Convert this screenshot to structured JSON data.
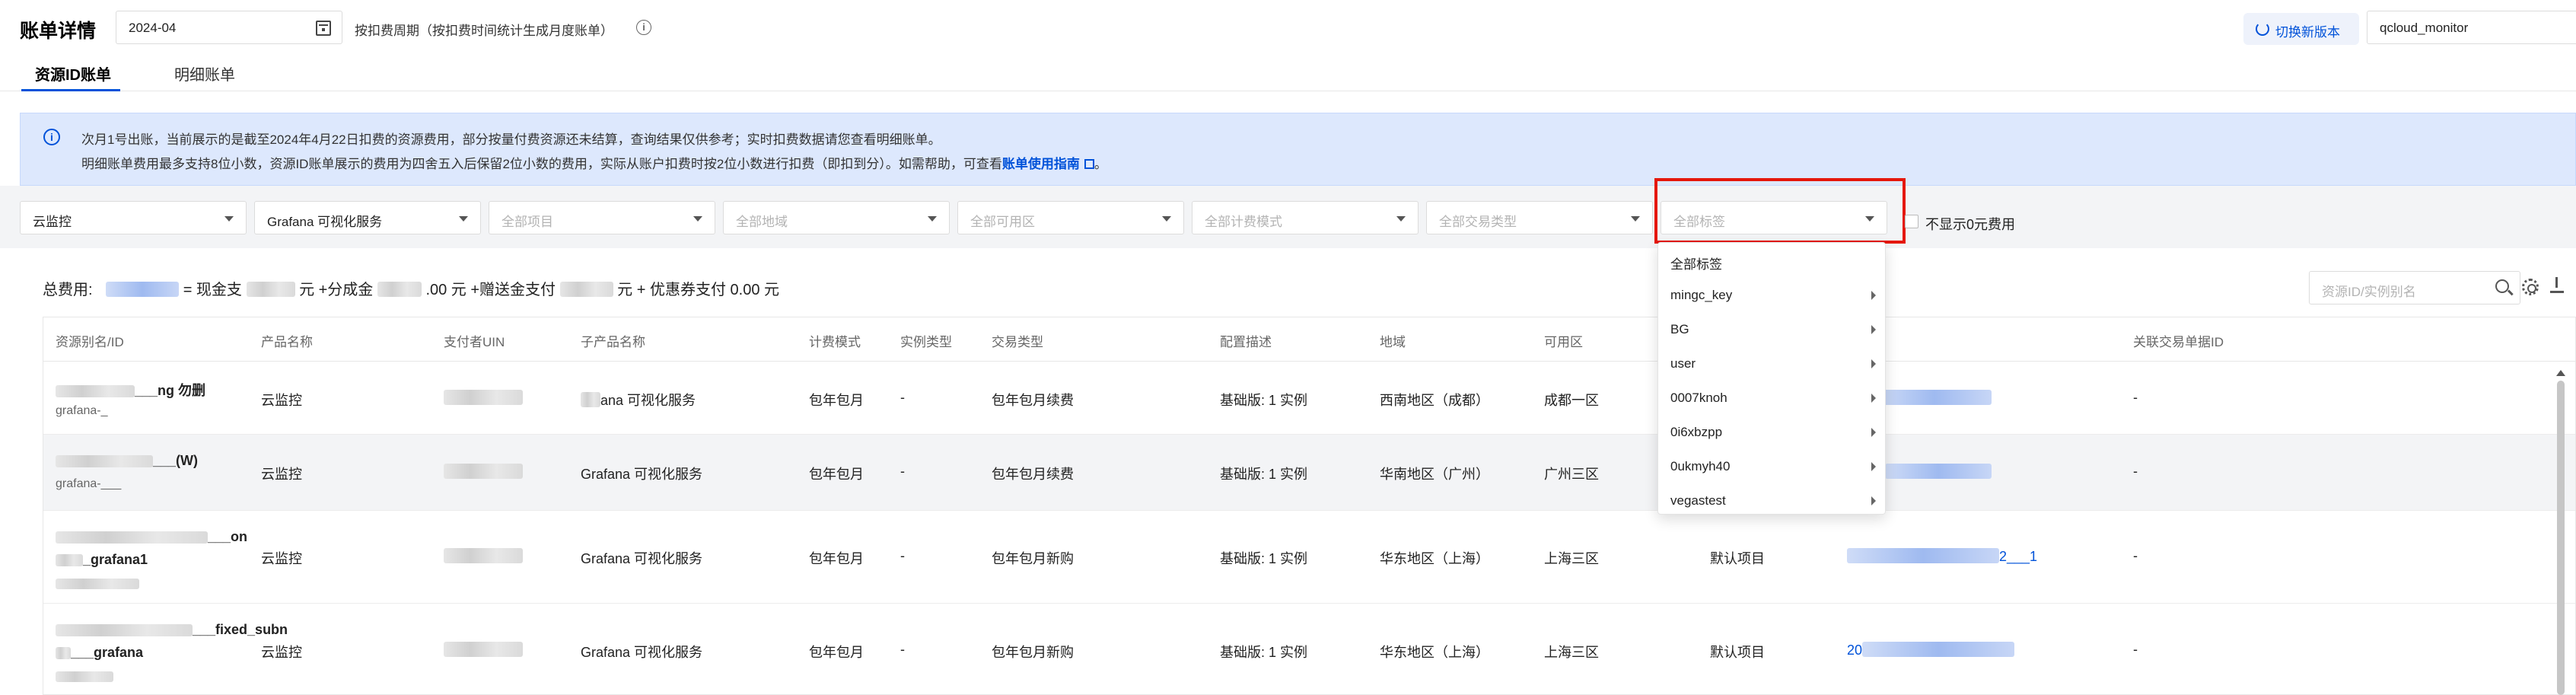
{
  "header": {
    "title": "账单详情",
    "month": "2024-04",
    "period_note": "按扣费周期（按扣费时间统计生成月度账单）",
    "switch_label": "切换新版本",
    "account": "qcloud_monitor"
  },
  "tabs": [
    {
      "label": "资源ID账单",
      "active": true
    },
    {
      "label": "明细账单",
      "active": false
    }
  ],
  "notice": {
    "line1": "次月1号出账，当前展示的是截至2024年4月22日扣费的资源费用，部分按量付费资源还未结算，查询结果仅供参考；实时扣费数据请您查看明细账单。",
    "line2_pre": "明细账单费用最多支持8位小数，资源ID账单展示的费用为四舍五入后保留2位小数的费用，实际从账户扣费时按2位小数进行扣费（即扣到分）。如需帮助，可查看",
    "line2_link": "账单使用指南",
    "line2_post": "。"
  },
  "filters": [
    {
      "value": "云监控",
      "placeholder": false
    },
    {
      "value": "Grafana 可视化服务",
      "placeholder": false
    },
    {
      "value": "全部项目",
      "placeholder": true
    },
    {
      "value": "全部地域",
      "placeholder": true
    },
    {
      "value": "全部可用区",
      "placeholder": true
    },
    {
      "value": "全部计费模式",
      "placeholder": true
    },
    {
      "value": "全部交易类型",
      "placeholder": true
    },
    {
      "value": "全部标签",
      "placeholder": true
    }
  ],
  "hide_zero_label": "不显示0元费用",
  "totals": {
    "label": "总费用:",
    "cash_label": "= 现金支",
    "unit1": "元 +分成金",
    "mid": ".00 元 +赠送金支付",
    "unit2": "元 + 优惠券支付",
    "coupon": "0.00 元"
  },
  "search_placeholder": "资源ID/实例别名",
  "table": {
    "columns": [
      "资源别名/ID",
      "产品名称",
      "支付者UIN",
      "子产品名称",
      "计费模式",
      "实例类型",
      "交易类型",
      "配置描述",
      "地域",
      "可用区",
      "",
      "",
      "关联交易单据ID"
    ],
    "rows": [
      {
        "alias": "___ng 勿删",
        "alias_sub": "grafana-_",
        "product": "云监控",
        "payer": "",
        "subproduct": "ana 可视化服务",
        "billing": "包年包月",
        "instance_type": "-",
        "trade": "包年包月续费",
        "config": "基础版: 1 实例",
        "region": "西南地区（成都）",
        "zone": "成都一区",
        "project": "",
        "order": "2402",
        "related": "-"
      },
      {
        "alias": "___(W)",
        "alias_sub": "grafana-___",
        "product": "云监控",
        "payer": "",
        "subproduct": "Grafana 可视化服务",
        "billing": "包年包月",
        "instance_type": "-",
        "trade": "包年包月续费",
        "config": "基础版: 1 实例",
        "region": "华南地区（广州）",
        "zone": "广州三区",
        "project": "",
        "order": "24046",
        "related": "-"
      },
      {
        "alias": "___on",
        "alias_sub": "_grafana1",
        "product": "云监控",
        "payer": "",
        "subproduct": "Grafana 可视化服务",
        "billing": "包年包月",
        "instance_type": "-",
        "trade": "包年包月新购",
        "config": "基础版: 1 实例",
        "region": "华东地区（上海）",
        "zone": "上海三区",
        "project": "默认项目",
        "order": "2___1",
        "related": "-"
      },
      {
        "alias": "___fixed_subn",
        "alias_sub": "___grafana",
        "product": "云监控",
        "payer": "",
        "subproduct": "Grafana 可视化服务",
        "billing": "包年包月",
        "instance_type": "-",
        "trade": "包年包月新购",
        "config": "基础版: 1 实例",
        "region": "华东地区（上海）",
        "zone": "上海三区",
        "project": "默认项目",
        "order": "20",
        "related": "-"
      }
    ]
  },
  "tag_dropdown": {
    "items": [
      {
        "label": "全部标签",
        "submenu": false
      },
      {
        "label": "mingc_key",
        "submenu": true
      },
      {
        "label": "BG",
        "submenu": true
      },
      {
        "label": "user",
        "submenu": true
      },
      {
        "label": "0007knoh",
        "submenu": true
      },
      {
        "label": "0i6xbzpp",
        "submenu": true
      },
      {
        "label": "0ukmyh40",
        "submenu": true
      },
      {
        "label": "vegastest",
        "submenu": true
      }
    ]
  },
  "colors": {
    "accent": "#0052d9",
    "highlight": "#e5170b",
    "notice_bg": "#dde8fd"
  }
}
